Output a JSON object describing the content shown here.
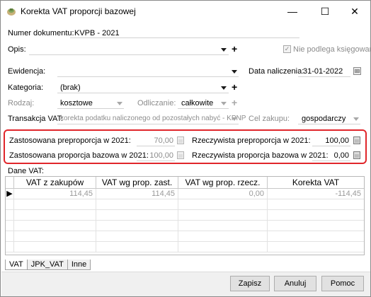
{
  "window": {
    "title": "Korekta VAT proporcji bazowej",
    "minimize": "—",
    "maximize": "☐",
    "close": "✕"
  },
  "form": {
    "numer_label": "Numer dokumentu:",
    "numer_value": "KVPB - 2021",
    "opis_label": "Opis:",
    "opis_value": "",
    "nie_podlega_label": "Nie podlega księgowaniu",
    "nie_podlega_checked": true,
    "ewidencja_label": "Ewidencja:",
    "ewidencja_value": "",
    "data_label": "Data naliczenia:",
    "data_value": "31-01-2022",
    "kategoria_label": "Kategoria:",
    "kategoria_value": "(brak)",
    "rodzaj_label": "Rodzaj:",
    "rodzaj_value": "kosztowe",
    "odliczanie_label": "Odliczanie:",
    "odliczanie_value": "całkowite",
    "transakcja_label": "Transakcja VAT:",
    "transakcja_value": "korekta podatku naliczonego od pozostałych nabyć - KPNP",
    "cel_label": "Cel zakupu:",
    "cel_value": "gospodarczy"
  },
  "proporcje": {
    "zast_preproporcja_label": "Zastosowana preproporcja w 2021:",
    "zast_preproporcja_value": "70,00",
    "rzecz_preproporcja_label": "Rzeczywista preproporcja w 2021:",
    "rzecz_preproporcja_value": "100,00",
    "zast_bazowa_label": "Zastosowana proporcja bazowa w 2021:",
    "zast_bazowa_value": "100,00",
    "rzecz_bazowa_label": "Rzeczywista proporcja bazowa w 2021:",
    "rzecz_bazowa_value": "0,00"
  },
  "dane_vat": {
    "label": "Dane VAT:",
    "columns": [
      "VAT z zakupów",
      "VAT wg prop. zast.",
      "VAT wg prop. rzecz.",
      "Korekta VAT"
    ],
    "rows": [
      {
        "indicator": "▶",
        "cells": [
          "114,45",
          "114,45",
          "0,00",
          "-114,45"
        ]
      }
    ]
  },
  "tabs": [
    "VAT",
    "JPK_VAT",
    "Inne"
  ],
  "buttons": {
    "save": "Zapisz",
    "cancel": "Anuluj",
    "help": "Pomoc"
  },
  "colors": {
    "highlight": "#e0262b"
  }
}
